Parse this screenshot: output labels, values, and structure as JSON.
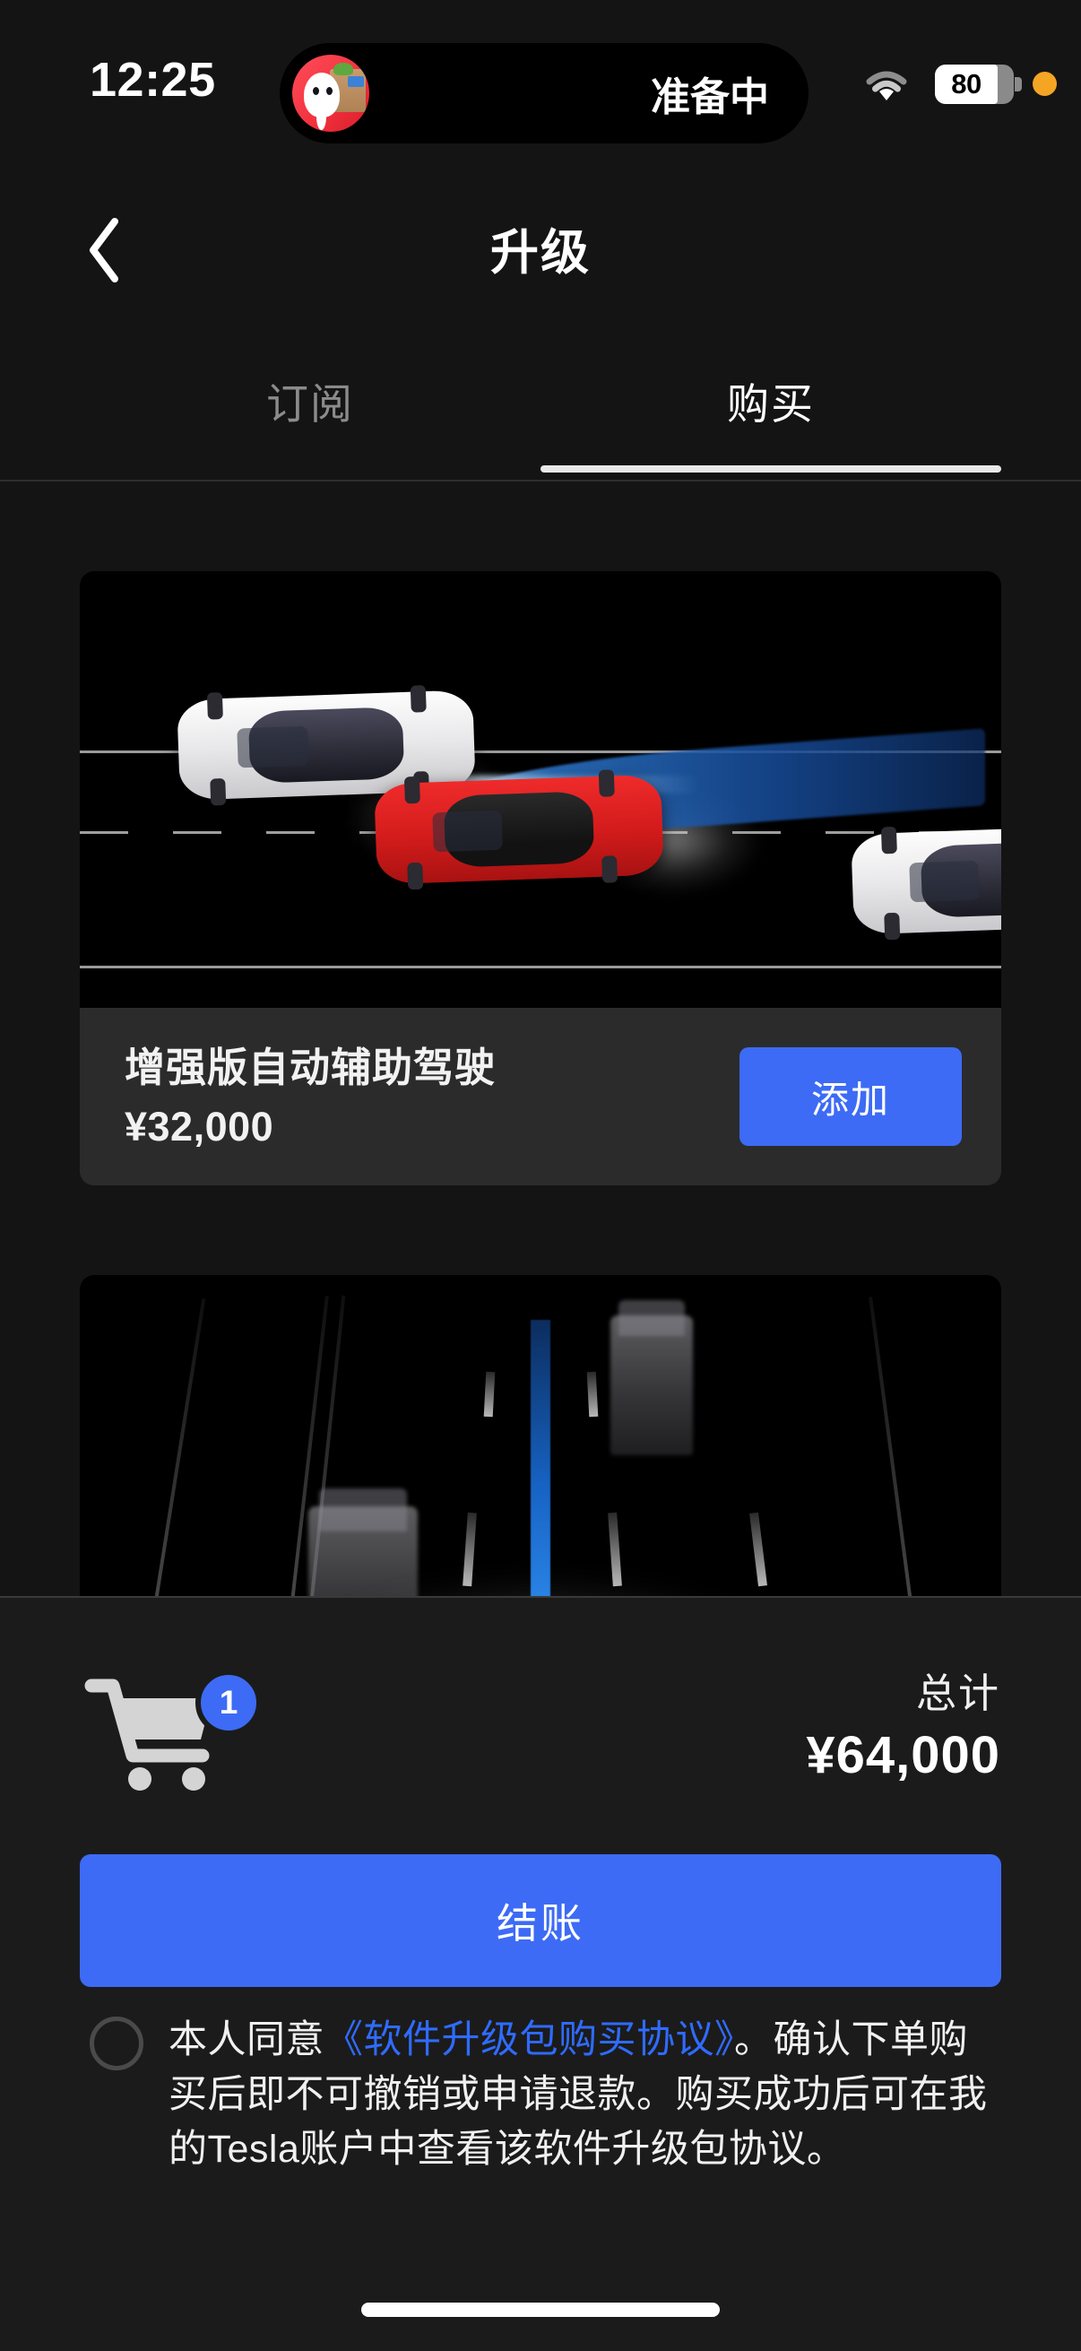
{
  "status_bar": {
    "time": "12:25",
    "dynamic_island_status": "准备中",
    "wifi_icon": "wifi-icon",
    "battery_percent": "80",
    "privacy_indicator": "orange-privacy-dot",
    "app_avatar_icon": "delivery-app-avatar-icon"
  },
  "navbar": {
    "back_icon": "chevron-left-icon",
    "title": "升级"
  },
  "tabs": {
    "items": [
      {
        "label": "订阅",
        "active": false
      },
      {
        "label": "购买",
        "active": true
      }
    ]
  },
  "products": [
    {
      "name": "增强版自动辅助驾驶",
      "price": "¥32,000",
      "action_label": "添加",
      "media_alt": "tesla-lane-change-illustration"
    },
    {
      "name": "",
      "price": "",
      "action_label": "",
      "media_alt": "tesla-fsd-forward-road-visualization"
    }
  ],
  "cart": {
    "cart_icon": "shopping-cart-icon",
    "badge_count": "1",
    "total_label": "总计",
    "total_amount": "¥64,000"
  },
  "checkout": {
    "button_label": "结账"
  },
  "agreement": {
    "checkbox_state": "unchecked",
    "text_before_link": "本人同意",
    "link_text": "《软件升级包购买协议》",
    "text_after_link": "。确认下单购买后即不可撤销或申请退款。购买成功后可在我的Tesla账户中查看该软件升级包协议。"
  },
  "colors": {
    "page_background": "#141414",
    "card_background": "#2b2b2b",
    "sheet_background": "#1b1b1b",
    "accent_blue": "#3d6bf5",
    "link_blue": "#2f6bff",
    "text_primary": "#ffffff",
    "text_muted": "#8b8b8b",
    "privacy_orange": "#f5a524"
  }
}
